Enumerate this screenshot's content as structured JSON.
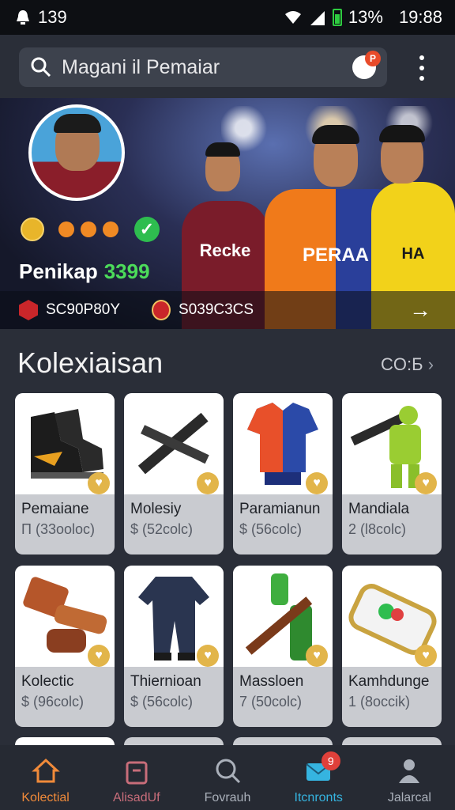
{
  "status": {
    "left_count": "139",
    "battery": "13%",
    "time": "19:88"
  },
  "search": {
    "placeholder": "Magani il Pemaiar",
    "badge": "P"
  },
  "profile": {
    "name": "Penikap",
    "points": "3399",
    "stat1": "SC90P80Y",
    "stat2": "S039C3CS",
    "player_shirts": [
      "Recke",
      "PERAA",
      "HA"
    ]
  },
  "collection": {
    "title": "Kolexiaisan",
    "see_all": "CO:Б",
    "items": [
      {
        "name": "Pemaiane",
        "price": "Π (33ooloc)"
      },
      {
        "name": "Molesiy",
        "price": "$ (52colc)"
      },
      {
        "name": "Paramianun",
        "price": "$ (56colc)"
      },
      {
        "name": "Mandiala",
        "price": "2 (l8colc)"
      },
      {
        "name": "Kolectic",
        "price": "$ (96colc)"
      },
      {
        "name": "Thiernioan",
        "price": "$ (56colc)"
      },
      {
        "name": "Massloen",
        "price": "7 (50colc)"
      },
      {
        "name": "Kamhdunge",
        "price": "1 (8occik)"
      }
    ]
  },
  "nav": {
    "tabs": [
      {
        "label": "Kolectial",
        "color": "#f08a3a"
      },
      {
        "label": "AlisadUf",
        "color": "#c86d7a"
      },
      {
        "label": "Fovrauh",
        "color": "#aab0ba"
      },
      {
        "label": "Itcnronts",
        "color": "#35b4e0",
        "badge": "9"
      },
      {
        "label": "Jalarcal",
        "color": "#aab0ba"
      }
    ]
  }
}
